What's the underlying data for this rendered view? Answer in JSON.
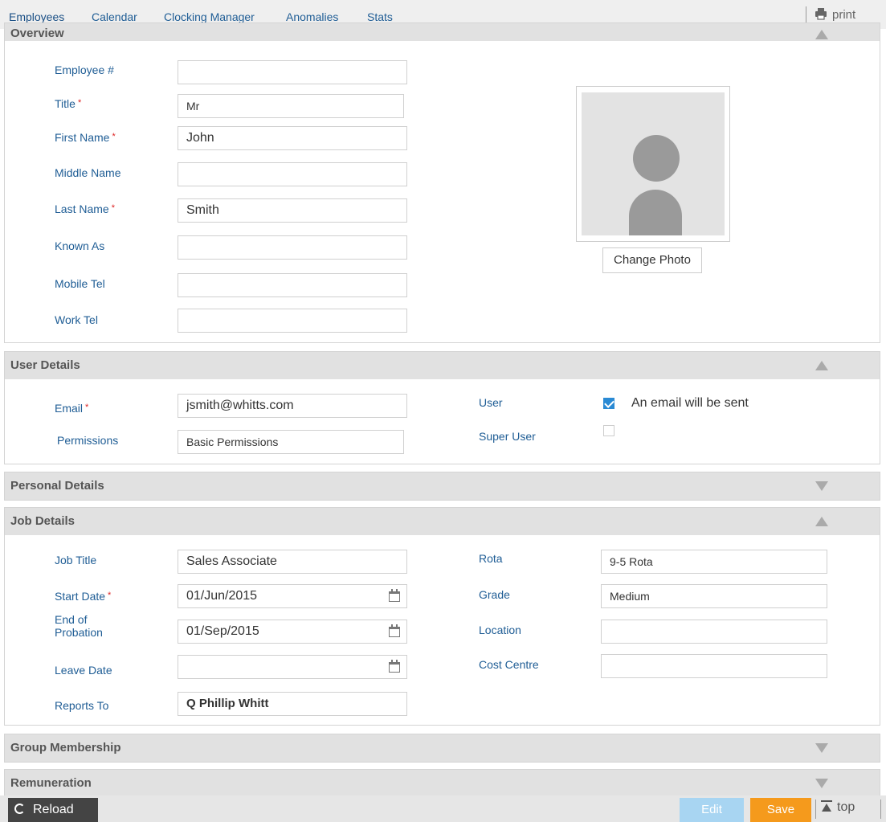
{
  "nav": {
    "tabs": [
      "Employees",
      "Calendar",
      "Clocking Manager",
      "Anomalies",
      "Stats"
    ],
    "print_label": "print"
  },
  "overview": {
    "title": "Overview",
    "fields": {
      "employee_no": {
        "label": "Employee #",
        "value": ""
      },
      "title": {
        "label": "Title",
        "value": "Mr"
      },
      "first_name": {
        "label": "First Name",
        "value": "John"
      },
      "middle_name": {
        "label": "Middle Name",
        "value": ""
      },
      "last_name": {
        "label": "Last Name",
        "value": "Smith"
      },
      "known_as": {
        "label": "Known As",
        "value": ""
      },
      "mobile_tel": {
        "label": "Mobile Tel",
        "value": ""
      },
      "work_tel": {
        "label": "Work Tel",
        "value": ""
      }
    },
    "change_photo_label": "Change Photo"
  },
  "user_details": {
    "title": "User Details",
    "email": {
      "label": "Email",
      "value": "jsmith@whitts.com"
    },
    "permissions": {
      "label": "Permissions",
      "value": "Basic Permissions"
    },
    "user": {
      "label": "User",
      "checked": true,
      "note": "An email will be sent"
    },
    "super_user": {
      "label": "Super User",
      "checked": false
    }
  },
  "personal_details": {
    "title": "Personal Details"
  },
  "job_details": {
    "title": "Job Details",
    "job_title": {
      "label": "Job Title",
      "value": "Sales Associate"
    },
    "start_date": {
      "label": "Start Date",
      "value": "01/Jun/2015"
    },
    "end_probation": {
      "label": "End of Probation",
      "value": "01/Sep/2015"
    },
    "leave_date": {
      "label": "Leave Date",
      "value": ""
    },
    "reports_to": {
      "label": "Reports To",
      "value": "Q Phillip Whitt"
    },
    "rota": {
      "label": "Rota",
      "value": "9-5 Rota"
    },
    "grade": {
      "label": "Grade",
      "value": "Medium"
    },
    "location": {
      "label": "Location",
      "value": ""
    },
    "cost_centre": {
      "label": "Cost Centre",
      "value": ""
    }
  },
  "group_membership": {
    "title": "Group Membership"
  },
  "remuneration": {
    "title": "Remuneration"
  },
  "bottom": {
    "reload_label": "Reload",
    "edit_label": "Edit",
    "save_label": "Save",
    "top_label": "top"
  },
  "colors": {
    "link_blue": "#1f5d95",
    "required_red": "#dd2222",
    "save_orange": "#f59a1c",
    "edit_blue": "#a8d5f2",
    "checkbox_blue": "#2a8ad4"
  }
}
